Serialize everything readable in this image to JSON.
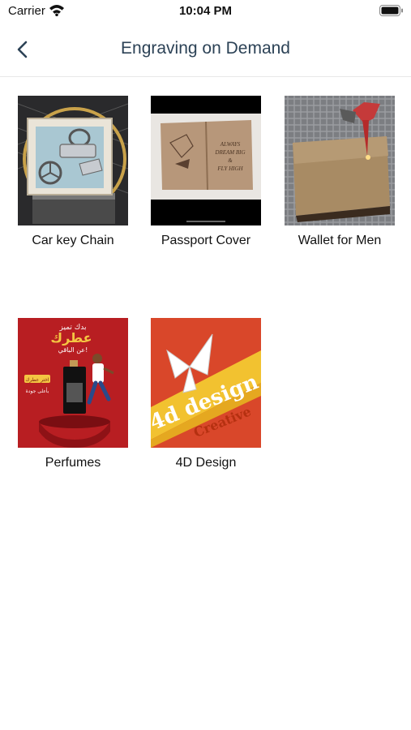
{
  "status_bar": {
    "carrier": "Carrier",
    "time": "10:04 PM"
  },
  "nav": {
    "title": "Engraving on Demand"
  },
  "items": [
    {
      "label": "Car key Chain",
      "image": "car-key-chain-image"
    },
    {
      "label": "Passport Cover",
      "image": "passport-cover-image",
      "engraving_lines": [
        "ALWAYS",
        "DREAM BIG",
        "&",
        "FLY HIGH"
      ]
    },
    {
      "label": "Wallet for Men",
      "image": "wallet-image"
    },
    {
      "label": "Perfumes",
      "image": "perfume-poster-image",
      "poster_text": [
        "بدك تميز",
        "عطرك",
        "عن الباقي!",
        "اختر عطرك",
        "بأعلى جودة"
      ]
    },
    {
      "label": "4D Design",
      "image": "4d-design-image",
      "poster_text": [
        "4d design",
        "Creative"
      ]
    }
  ],
  "colors": {
    "title": "#2c4256",
    "accent": "#2c4256"
  }
}
